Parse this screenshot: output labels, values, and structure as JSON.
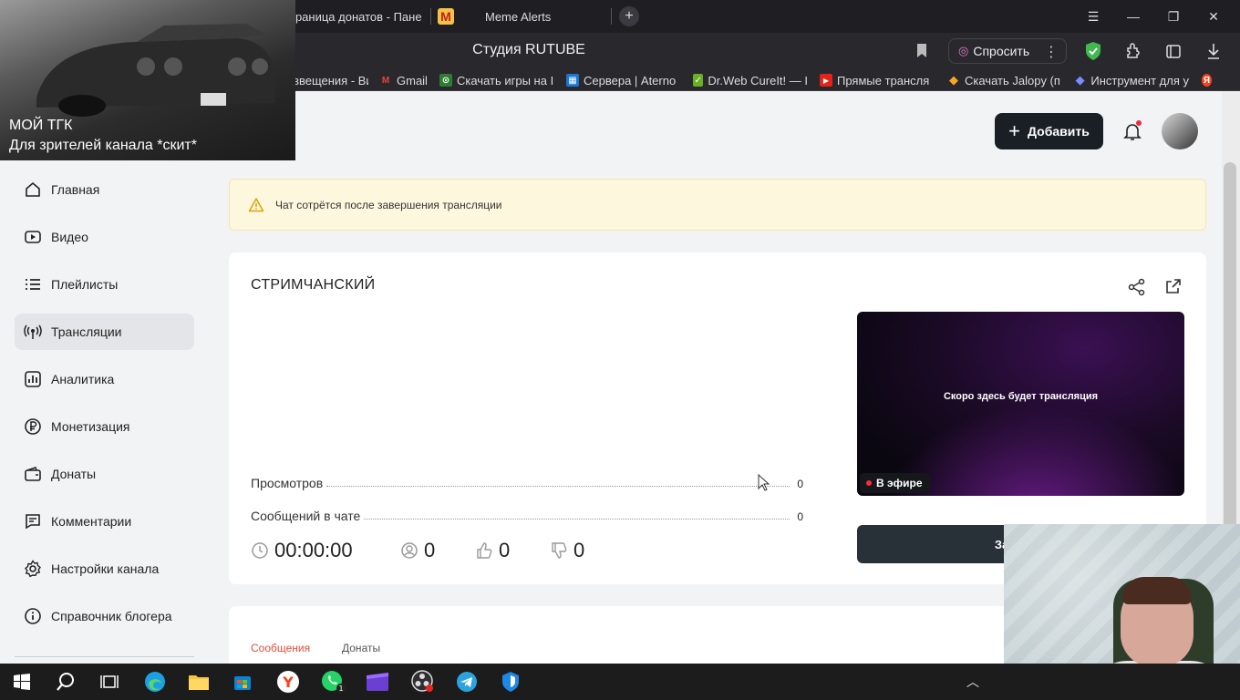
{
  "browser": {
    "tabs": [
      {
        "label": "траница донатов - Пане"
      },
      {
        "label": "Meme Alerts",
        "logo_letter": "M"
      }
    ],
    "window_title": "Студия RUTUBE",
    "ask_button": "Спросить",
    "bookmarks": [
      {
        "label": "звещения - Ви"
      },
      {
        "label": "Gmail",
        "icon_letter": "M",
        "color": "#ea4335"
      },
      {
        "label": "Скачать игры на I",
        "icon_letter": "⊙",
        "color": "#2e7d32"
      },
      {
        "label": "Сервера | Aterno",
        "icon_letter": "▦",
        "color": "#1976d2"
      },
      {
        "label": "Dr.Web CureIt! — I",
        "icon_letter": "✓",
        "color": "#6ab023"
      },
      {
        "label": "Прямые трансля",
        "icon_letter": "▶",
        "color": "#e62117"
      },
      {
        "label": "Скачать Jalopy (п",
        "icon_letter": "◆",
        "color": "#f5a623"
      },
      {
        "label": "Инструмент для у",
        "icon_letter": "◆",
        "color": "#7b8cff"
      }
    ],
    "yandex_badge": "Я"
  },
  "overlay_banner": {
    "line1": "МОЙ ТГК",
    "line2": "Для зрителей канала *скит*"
  },
  "header": {
    "add_button": "Добавить"
  },
  "sidebar": {
    "items": [
      {
        "label": "Главная",
        "icon": "home-icon"
      },
      {
        "label": "Видео",
        "icon": "video-icon"
      },
      {
        "label": "Плейлисты",
        "icon": "playlist-icon"
      },
      {
        "label": "Трансляции",
        "icon": "broadcast-icon",
        "active": true
      },
      {
        "label": "Аналитика",
        "icon": "analytics-icon"
      },
      {
        "label": "Монетизация",
        "icon": "ruble-icon"
      },
      {
        "label": "Донаты",
        "icon": "wallet-icon"
      },
      {
        "label": "Комментарии",
        "icon": "comment-icon"
      },
      {
        "label": "Настройки канала",
        "icon": "gear-icon"
      },
      {
        "label": "Справочник блогера",
        "icon": "info-icon"
      }
    ]
  },
  "warning": {
    "text": "Чат сотрётся после завершения трансляции"
  },
  "stream": {
    "title": "СТРИМЧАНСКИЙ",
    "stats": [
      {
        "label": "Просмотров",
        "value": "0"
      },
      {
        "label": "Сообщений в чате",
        "value": "0"
      }
    ],
    "preview_text": "Скоро здесь будет трансляция",
    "live_badge": "В эфире",
    "end_button": "Заверши",
    "duration": "00:00:00",
    "viewers": "0",
    "likes": "0",
    "dislikes": "0"
  },
  "chat_tabs": {
    "messages": "Сообщения",
    "donations": "Донаты"
  },
  "colors": {
    "accent_dark": "#1a1f26",
    "warning_bg": "#fdf7de",
    "active_tab": "#e74c3c",
    "live_red": "#ff2b3d"
  }
}
